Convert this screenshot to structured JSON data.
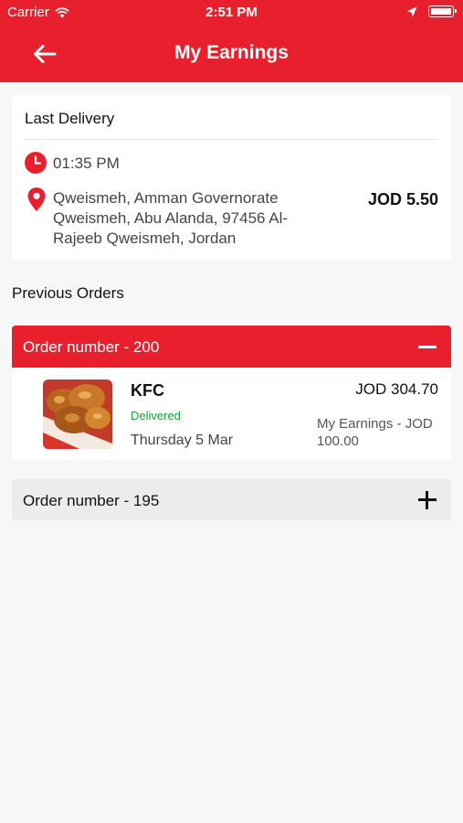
{
  "status_bar": {
    "carrier": "Carrier",
    "time": "2:51 PM"
  },
  "nav": {
    "title": "My Earnings",
    "back_icon": "arrow-left-icon"
  },
  "last_delivery": {
    "heading": "Last Delivery",
    "time": "01:35 PM",
    "address": "Qweismeh, Amman Governorate Qweismeh, Abu Alanda, 97456 Al-Rajeeb Qweismeh, Jordan",
    "amount": "JOD 5.50"
  },
  "previous_orders": {
    "title": "Previous Orders",
    "orders": [
      {
        "label": "Order number - 200",
        "expanded": true,
        "store": "KFC",
        "status": "Delivered",
        "date": "Thursday 5 Mar",
        "total": "JOD 304.70",
        "earnings": "My Earnings - JOD 100.00"
      },
      {
        "label": "Order number - 195",
        "expanded": false
      }
    ]
  },
  "colors": {
    "brand_red": "#e8202e",
    "delivered_green": "#1aa130"
  }
}
